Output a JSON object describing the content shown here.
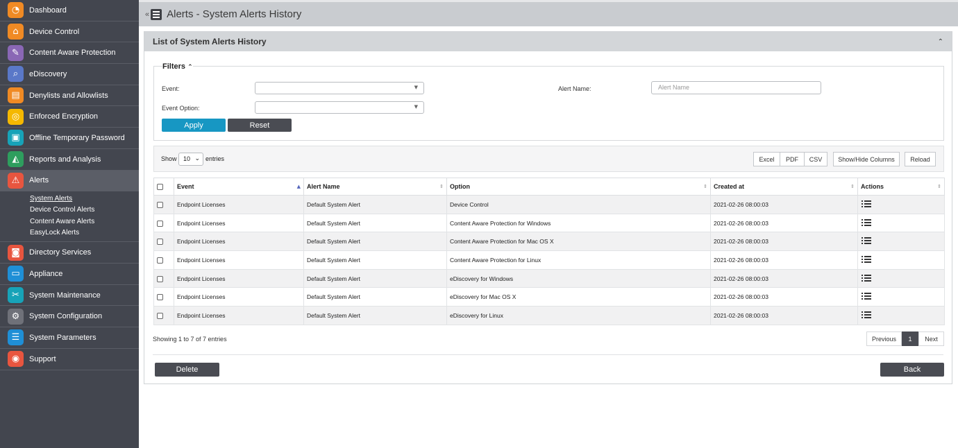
{
  "sidebar": {
    "items": [
      {
        "label": "Dashboard",
        "icon": "dashboard-icon",
        "color": "#f08a24",
        "glyph": "◔"
      },
      {
        "label": "Device Control",
        "icon": "device-control-icon",
        "color": "#f08a24",
        "glyph": "⌂"
      },
      {
        "label": "Content Aware Protection",
        "icon": "content-aware-icon",
        "color": "#8a67b5",
        "glyph": "✎"
      },
      {
        "label": "eDiscovery",
        "icon": "ediscovery-icon",
        "color": "#5a78c8",
        "glyph": "⌕"
      },
      {
        "label": "Denylists and Allowlists",
        "icon": "lists-icon",
        "color": "#f08a24",
        "glyph": "▤"
      },
      {
        "label": "Enforced Encryption",
        "icon": "encryption-icon",
        "color": "#f5b800",
        "glyph": "◎"
      },
      {
        "label": "Offline Temporary Password",
        "icon": "password-icon",
        "color": "#17a3b8",
        "glyph": "▣"
      },
      {
        "label": "Reports and Analysis",
        "icon": "reports-icon",
        "color": "#2e9e5e",
        "glyph": "◭"
      },
      {
        "label": "Alerts",
        "icon": "alert-icon",
        "color": "#e8553f",
        "glyph": "⚠"
      },
      {
        "label": "Directory Services",
        "icon": "directory-icon",
        "color": "#e8553f",
        "glyph": "◙"
      },
      {
        "label": "Appliance",
        "icon": "appliance-icon",
        "color": "#1f8fd6",
        "glyph": "▭"
      },
      {
        "label": "System Maintenance",
        "icon": "maintenance-icon",
        "color": "#17a3b8",
        "glyph": "✂"
      },
      {
        "label": "System Configuration",
        "icon": "configuration-icon",
        "color": "#6f7179",
        "glyph": "⚙"
      },
      {
        "label": "System Parameters",
        "icon": "parameters-icon",
        "color": "#1f8fd6",
        "glyph": "☰"
      },
      {
        "label": "Support",
        "icon": "support-icon",
        "color": "#e8553f",
        "glyph": "◉"
      }
    ],
    "subitems": [
      "System Alerts",
      "Device Control Alerts",
      "Content Aware Alerts",
      "EasyLock Alerts"
    ]
  },
  "topbar": {
    "collapse": "«",
    "title": "Alerts - System Alerts History"
  },
  "panel": {
    "title": "List of System Alerts History"
  },
  "filters": {
    "title": "Filters",
    "event_label": "Event:",
    "event_option_label": "Event Option:",
    "alert_name_label": "Alert Name:",
    "alert_name_placeholder": "Alert Name",
    "apply": "Apply",
    "reset": "Reset"
  },
  "toolbar": {
    "show": "Show",
    "length": "10",
    "entries": "entries",
    "excel": "Excel",
    "pdf": "PDF",
    "csv": "CSV",
    "show_hide": "Show/Hide Columns",
    "reload": "Reload"
  },
  "table": {
    "headers": {
      "event": "Event",
      "alert_name": "Alert Name",
      "option": "Option",
      "created_at": "Created at",
      "actions": "Actions"
    },
    "rows": [
      {
        "event": "Endpoint Licenses",
        "alert_name": "Default System Alert",
        "option": "Device Control",
        "created_at": "2021-02-26 08:00:03"
      },
      {
        "event": "Endpoint Licenses",
        "alert_name": "Default System Alert",
        "option": "Content Aware Protection for Windows",
        "created_at": "2021-02-26 08:00:03"
      },
      {
        "event": "Endpoint Licenses",
        "alert_name": "Default System Alert",
        "option": "Content Aware Protection for Mac OS X",
        "created_at": "2021-02-26 08:00:03"
      },
      {
        "event": "Endpoint Licenses",
        "alert_name": "Default System Alert",
        "option": "Content Aware Protection for Linux",
        "created_at": "2021-02-26 08:00:03"
      },
      {
        "event": "Endpoint Licenses",
        "alert_name": "Default System Alert",
        "option": "eDiscovery for Windows",
        "created_at": "2021-02-26 08:00:03"
      },
      {
        "event": "Endpoint Licenses",
        "alert_name": "Default System Alert",
        "option": "eDiscovery for Mac OS X",
        "created_at": "2021-02-26 08:00:03"
      },
      {
        "event": "Endpoint Licenses",
        "alert_name": "Default System Alert",
        "option": "eDiscovery for Linux",
        "created_at": "2021-02-26 08:00:03"
      }
    ]
  },
  "footer": {
    "info": "Showing 1 to 7 of 7 entries",
    "previous": "Previous",
    "page": "1",
    "next": "Next",
    "delete": "Delete",
    "back": "Back"
  },
  "colors": {
    "apply": "#1797c3",
    "dark_button": "#4a4c53",
    "sidebar": "#43464f"
  }
}
